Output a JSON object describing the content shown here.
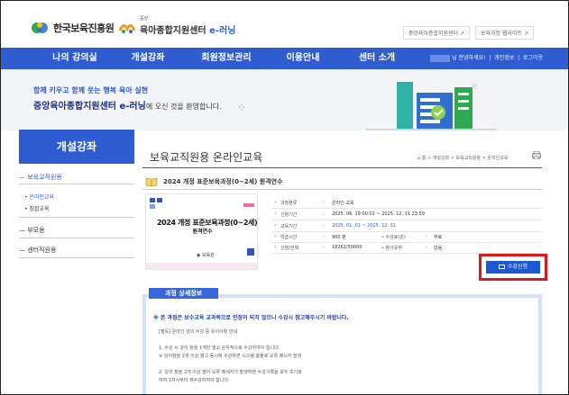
{
  "header": {
    "org_name": "한국보육진흥원",
    "site_small": "중앙",
    "site_name_prefix": "육아종합지원센터",
    "site_name_suffix": "e-러닝",
    "links": [
      "중앙육아종합지원센터 ↗",
      "보육과정 웹사이트 ↗"
    ]
  },
  "nav": {
    "items": [
      "나의 강의실",
      "개설강좌",
      "회원정보관리",
      "이용안내",
      "센터 소개"
    ],
    "greeting": "님 안녕하세요!",
    "user_links": [
      "개인정보",
      "로그아웃"
    ]
  },
  "banner": {
    "line1": "함께 키우고 함께 웃는 행복 육아 실현",
    "line2_bold": "중앙육아종합지원센터 e-러닝",
    "line2_rest": "에 오신 것을 환영합니다."
  },
  "sidebar": {
    "title": "개설강좌",
    "items": [
      {
        "label": "보육교직원용"
      },
      {
        "label": "부모용"
      },
      {
        "label": "센터직원용"
      }
    ],
    "subitems": [
      "• 온라인교육",
      "• 집합교육"
    ]
  },
  "main": {
    "page_title": "보육교직원용 온라인교육",
    "breadcrumb": "⌂ 홈 > 개설강좌 > 보육교직원용 > 온라인교육",
    "course_title": "2024 개정 표준보육과정(0~2세) 원격연수",
    "thumb_line1": "2024 개정 표준보육과정(0~2세)",
    "thumb_line2": "원격연수",
    "thumb_logo": "보육원",
    "info": {
      "category_label": "과정분류",
      "category_value": "온라인 교육",
      "apply_period_label": "신청기간",
      "apply_period_value": "2025. 06. 19 00:01 ~ 2025. 12. 31 23:59",
      "edu_period_label": "교육기간",
      "edu_period_value": "2025. 01. 01 ~ 2025. 12. 31",
      "hours_label": "학습시간",
      "hours_value": "900 분",
      "fee_label": "수강료(원)",
      "fee_value": "무료",
      "enroll_label": "신청/전체",
      "enroll_value": "18262/50000",
      "cert_label": "참가유무",
      "cert_value": "있음"
    },
    "apply_button": "수강신청"
  },
  "detail": {
    "tab_label": "과정 상세정보",
    "notice": "※ 본 과정은 보수교육 교과목으로 인정이 되지 않으니 수강시 참고해주시기 바랍니다.",
    "lines": [
      "[필독] 온라인 강의 수강 중 유의사항 안내",
      "1. 수강 시 강의 창을 1개만 열고 순차적으로 수강하여야 합니다.",
      "※ 강의창을 2개 이상 열고 동시에 수강하면 시스템 충돌로 오류 메시지 발생",
      "2. 강의 창을 2개 이상 열어 오류 메세지가 발생하면 수강기록을 모두 초기화",
      "하여 1차시부터 재수강하여야 합니다."
    ]
  },
  "colors": {
    "brand_blue": "#2f5cd0",
    "navy": "#1a2e88",
    "highlight_red": "#e0161b"
  }
}
